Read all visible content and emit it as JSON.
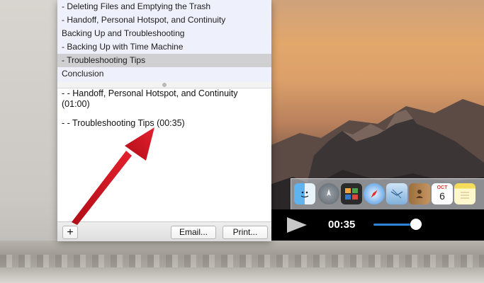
{
  "chapter_list": {
    "items": [
      {
        "label": "- Deleting Files and Emptying the Trash",
        "selected": false
      },
      {
        "label": "- Handoff, Personal Hotspot, and Continuity",
        "selected": false
      },
      {
        "label": "Backing Up and Troubleshooting",
        "selected": false
      },
      {
        "label": "- Backing Up with Time Machine",
        "selected": false
      },
      {
        "label": "- Troubleshooting Tips",
        "selected": true
      },
      {
        "label": "Conclusion",
        "selected": false
      }
    ]
  },
  "notes": {
    "entries": [
      {
        "text": "- - Handoff, Personal Hotspot, and Continuity (01:00)"
      },
      {
        "text": "- - Troubleshooting Tips (00:35)"
      }
    ]
  },
  "toolbar": {
    "add_label": "+",
    "email_label": "Email...",
    "print_label": "Print..."
  },
  "player": {
    "time": "00:35",
    "volume_fraction": 0.85
  },
  "dock": {
    "icons": [
      "finder-icon",
      "launchpad-icon",
      "mission-control-icon",
      "safari-icon",
      "mail-icon",
      "contacts-icon",
      "calendar-icon",
      "notes-icon"
    ],
    "calendar": {
      "month": "OCT",
      "day": "6"
    }
  },
  "colors": {
    "selection": "#d0d0d2",
    "list_background": "#eef1fb",
    "arrow": "#d0101e",
    "slider": "#2f83d8"
  }
}
